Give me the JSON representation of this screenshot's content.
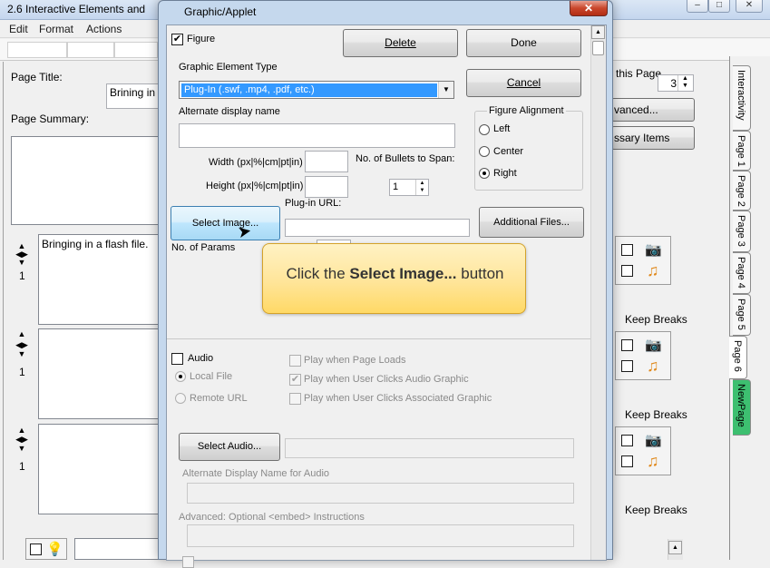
{
  "background_window": {
    "title": "2.6 Interactive Elements and",
    "caption_buttons": [
      "–",
      "□",
      "✕"
    ],
    "menu": [
      "Edit",
      "Format",
      "Actions"
    ],
    "page_title_label": "Page Title:",
    "page_title_value": "Brining in a",
    "page_summary_label": "Page Summary:",
    "this_page_label": "this Page",
    "this_page_value": "3",
    "advanced_button": "vanced...",
    "necessary_items_button": "ssary Items",
    "rows": [
      {
        "text": "Bringing in a flash file.",
        "number": "1",
        "keep_breaks": "Keep Breaks"
      },
      {
        "text": "",
        "number": "1",
        "keep_breaks": "Keep Breaks"
      },
      {
        "text": "",
        "number": "1",
        "keep_breaks": "Keep Breaks"
      }
    ],
    "side_tabs": [
      "Interactivity",
      "Page 1",
      "Page 2",
      "Page 3",
      "Page 4",
      "Page 5",
      "Page 6",
      "NewPage"
    ]
  },
  "dialog": {
    "title": "Graphic/Applet",
    "close": "✕",
    "figure_label": "Figure",
    "figure_checked": true,
    "delete_button": "Delete",
    "done_button": "Done",
    "cancel_button": "Cancel",
    "graphic_element_type_label": "Graphic Element Type",
    "graphic_element_type_value": "Plug-In (.swf, .mp4, .pdf, etc.)",
    "alternate_display_name_label": "Alternate display name",
    "alternate_display_name_value": "",
    "figure_alignment_label": "Figure Alignment",
    "alignment_options": [
      "Left",
      "Center",
      "Right"
    ],
    "alignment_selected": "Right",
    "width_label": "Width (px|%|cm|pt|in)",
    "height_label": "Height (px|%|cm|pt|in)",
    "bullets_label": "No. of Bullets to Span:",
    "bullets_value": "1",
    "plugin_url_label": "Plug-in URL:",
    "select_image_button": "Select Image...",
    "additional_files_button": "Additional Files...",
    "params_label": "No. of Params",
    "audio_label": "Audio",
    "local_file_label": "Local File",
    "remote_url_label": "Remote URL",
    "play_page_loads": "Play when Page Loads",
    "play_user_clicks_audio": "Play when User Clicks Audio Graphic",
    "play_user_clicks_associated": "Play when User Clicks Associated Graphic",
    "select_audio_button": "Select Audio...",
    "alt_audio_label": "Alternate Display Name for Audio",
    "advanced_embed_label": "Advanced: Optional <embed> Instructions"
  },
  "tooltip": {
    "prefix": "Click the ",
    "bold": "Select Image...",
    "suffix": " button"
  },
  "colors": {
    "dialog_frame": "#c5d8ed",
    "selection": "#3399ff",
    "tooltip_fill": "#ffe599",
    "new_page_tab": "#3dbf70",
    "close_button": "#c9462b"
  }
}
